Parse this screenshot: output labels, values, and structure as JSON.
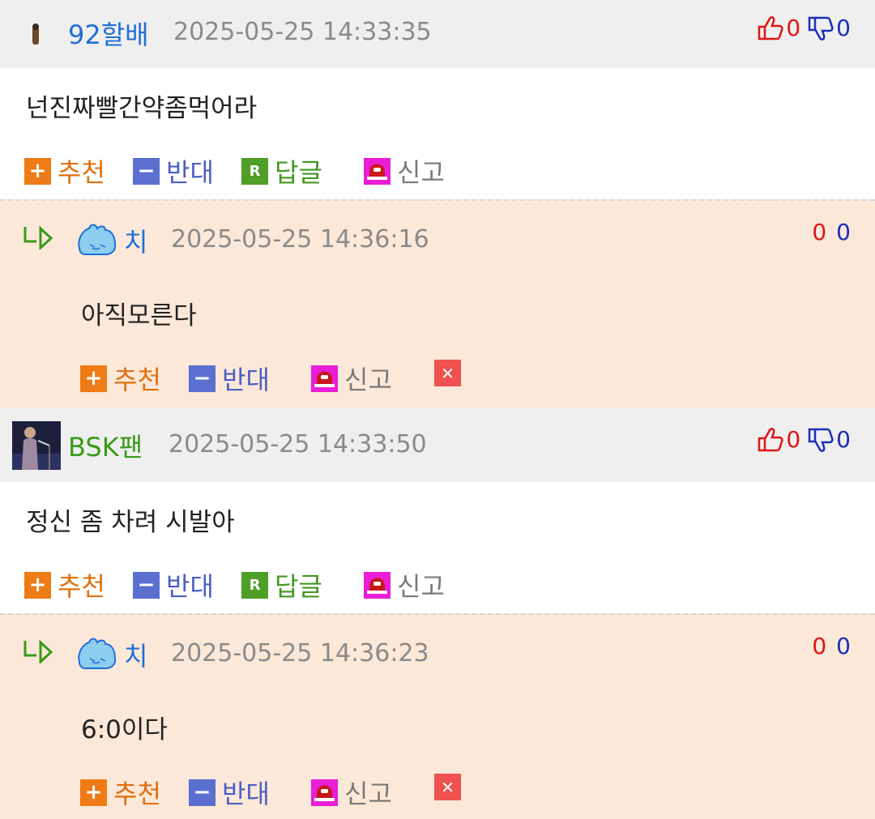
{
  "comments": [
    {
      "nick": "92할배",
      "date": "2025-05-25 14:33:35",
      "up": "0",
      "down": "0",
      "text": "넌진짜빨간약좀먹어라",
      "actions": {
        "recommend": "추천",
        "oppose": "반대",
        "reply": "답글",
        "report": "신고"
      },
      "reply": {
        "nick": "치",
        "date": "2025-05-25 14:36:16",
        "up": "0",
        "down": "0",
        "text": "아직모른다",
        "actions": {
          "recommend": "추천",
          "oppose": "반대",
          "report": "신고"
        }
      }
    },
    {
      "nick": "BSK팬",
      "date": "2025-05-25 14:33:50",
      "up": "0",
      "down": "0",
      "text": "정신 좀 차려 시발아",
      "actions": {
        "recommend": "추천",
        "oppose": "반대",
        "reply": "답글",
        "report": "신고"
      },
      "reply": {
        "nick": "치",
        "date": "2025-05-25 14:36:23",
        "up": "0",
        "down": "0",
        "text": "6:0이다",
        "actions": {
          "recommend": "추천",
          "oppose": "반대",
          "report": "신고"
        }
      }
    }
  ],
  "icons": {
    "thumbs_up": "thumbs-up-icon",
    "thumbs_down": "thumbs-down-icon",
    "reply_arrow": "reply-arrow-icon",
    "plus": "plus-icon",
    "minus": "minus-icon",
    "r_badge": "reply-badge-icon",
    "siren": "siren-icon",
    "close": "close-icon"
  },
  "colors": {
    "header_bg": "#efefef",
    "reply_bg": "#fce8d8",
    "nick_blue": "#1e6fd6",
    "nick_green": "#3a9a1a",
    "up_red": "#e01515",
    "down_blue": "#1b2fb8"
  }
}
